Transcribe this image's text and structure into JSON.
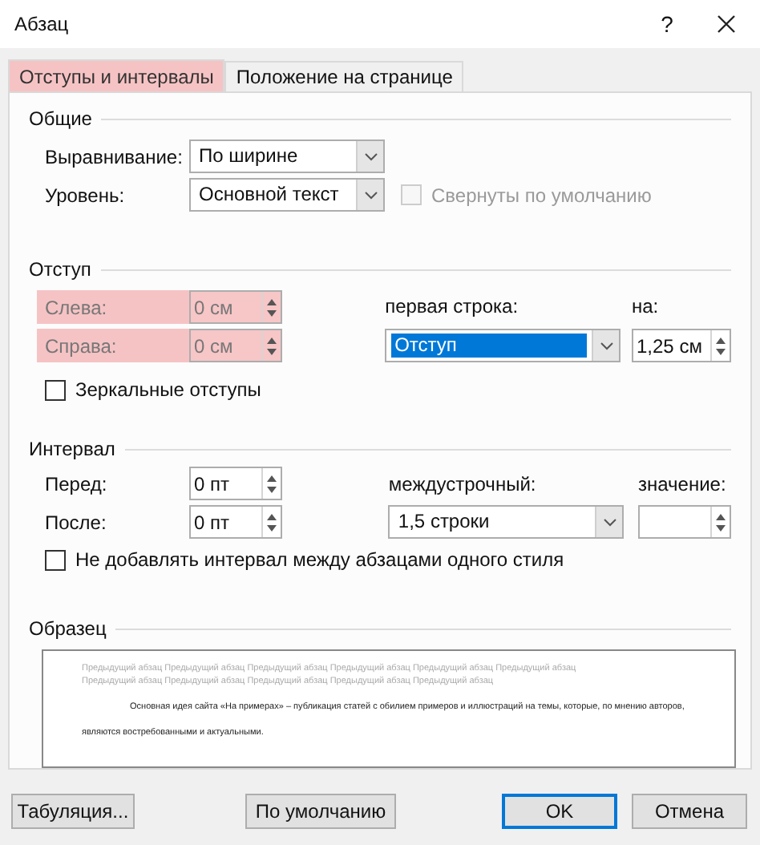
{
  "window": {
    "title": "Абзац",
    "help": "?"
  },
  "tabs": [
    {
      "label": "Отступы и интервалы",
      "selected": true,
      "highlighted": true
    },
    {
      "label": "Положение на странице",
      "selected": false,
      "highlighted": false
    }
  ],
  "general": {
    "title": "Общие",
    "fields": [
      {
        "label": "Выравнивание:",
        "value": "По ширине"
      },
      {
        "label": "Уровень:",
        "value": "Основной текст"
      }
    ],
    "collapsed": {
      "label": "Свернуты по умолчанию",
      "checked": false,
      "disabled": true
    }
  },
  "indent": {
    "title": "Отступ",
    "fields": [
      {
        "label": "Слева:",
        "value": "0 см",
        "highlighted": true
      },
      {
        "label": "Справа:",
        "value": "0 см",
        "highlighted": true
      }
    ],
    "first_line": {
      "label": "первая строка:",
      "value": "Отступ",
      "selected": true
    },
    "by": {
      "label": "на:",
      "value": "1,25 см"
    },
    "mirror": {
      "label": "Зеркальные отступы",
      "checked": false
    }
  },
  "spacing": {
    "title": "Интервал",
    "fields": [
      {
        "label": "Перед:",
        "value": "0 пт"
      },
      {
        "label": "После:",
        "value": "0 пт"
      }
    ],
    "line": {
      "label": "междустрочный:",
      "value": "1,5 строки"
    },
    "at": {
      "label": "значение:"
    },
    "dont_add": {
      "label": "Не добавлять интервал между абзацами одного стиля",
      "checked": false
    }
  },
  "preview": {
    "title": "Образец",
    "previous": "Предыдущий абзац Предыдущий абзац Предыдущий абзац Предыдущий абзац Предыдущий абзац Предыдущий абзац Предыдущий абзац Предыдущий абзац Предыдущий абзац Предыдущий абзац Предыдущий абзац",
    "text": "Основная идея сайта «На примерах» – публикация статей с обилием примеров и иллюстраций на темы, которые, по мнению авторов, являются востребованными и актуальными."
  },
  "buttons": [
    {
      "label": "Табуляция...",
      "default": false
    },
    {
      "label": "По умолчанию",
      "default": false
    },
    {
      "label": "OK",
      "default": true
    },
    {
      "label": "Отмена",
      "default": false
    }
  ]
}
